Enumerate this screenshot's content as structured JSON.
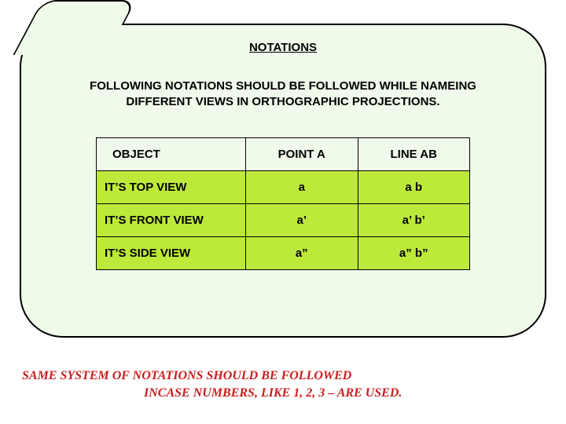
{
  "title": "NOTATIONS",
  "subtitle_l1": "FOLLOWING NOTATIONS SHOULD BE FOLLOWED WHILE NAMEING",
  "subtitle_l2": "DIFFERENT VIEWS IN ORTHOGRAPHIC PROJECTIONS.",
  "table": {
    "headers": {
      "c1": "OBJECT",
      "c2": "POINT  A",
      "c3": "LINE  AB"
    },
    "rows": [
      {
        "label": "IT’S TOP VIEW",
        "point": "a",
        "line": "a b"
      },
      {
        "label": "IT’S FRONT VIEW",
        "point": "a’",
        "line": "a’ b’"
      },
      {
        "label": "IT’S SIDE VIEW",
        "point": "a”",
        "line": "a” b”"
      }
    ]
  },
  "footer_l1": "SAME SYSTEM OF NOTATIONS SHOULD BE FOLLOWED",
  "footer_l2": "INCASE NUMBERS, LIKE 1, 2, 3 – ARE USED."
}
